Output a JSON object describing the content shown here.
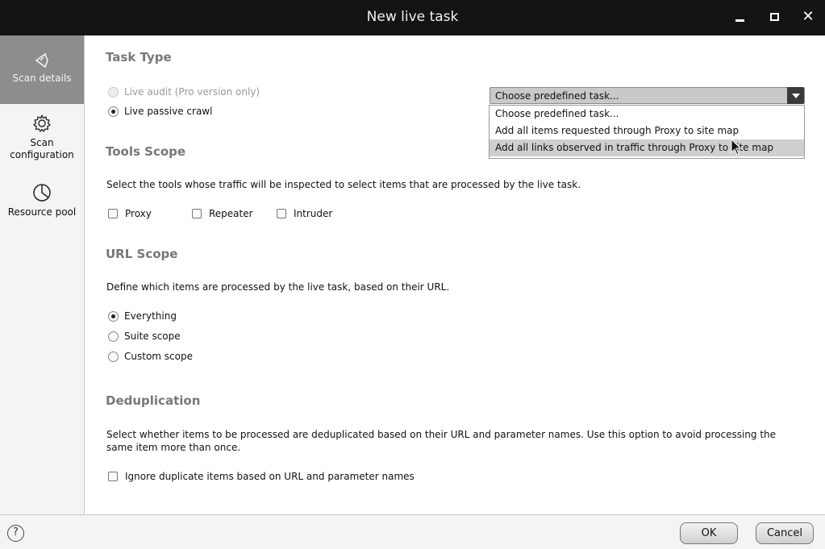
{
  "window": {
    "title": "New live task"
  },
  "sidebar": {
    "items": [
      {
        "label": "Scan details",
        "icon": "scan-details-icon",
        "active": true
      },
      {
        "label": "Scan configuration",
        "icon": "gear-icon",
        "active": false
      },
      {
        "label": "Resource pool",
        "icon": "pie-chart-icon",
        "active": false
      }
    ]
  },
  "task_type": {
    "heading": "Task Type",
    "options": [
      {
        "label": "Live audit (Pro version only)",
        "selected": false,
        "disabled": true
      },
      {
        "label": "Live passive crawl",
        "selected": true,
        "disabled": false
      }
    ],
    "dropdown": {
      "selected": "Choose predefined task...",
      "options": [
        "Choose predefined task...",
        "Add all items requested through Proxy to site map",
        "Add all links observed in traffic through Proxy to site map"
      ],
      "highlighted_index": 2
    }
  },
  "tools_scope": {
    "heading": "Tools Scope",
    "description": "Select the tools whose traffic will be inspected to select items that are processed by the live task.",
    "tools": [
      {
        "label": "Proxy",
        "checked": false
      },
      {
        "label": "Repeater",
        "checked": false
      },
      {
        "label": "Intruder",
        "checked": false
      }
    ]
  },
  "url_scope": {
    "heading": "URL Scope",
    "description": "Define which items are processed by the live task, based on their URL.",
    "options": [
      {
        "label": "Everything",
        "selected": true
      },
      {
        "label": "Suite scope",
        "selected": false
      },
      {
        "label": "Custom scope",
        "selected": false
      }
    ]
  },
  "deduplication": {
    "heading": "Deduplication",
    "description_line1": "Select whether items to be processed are deduplicated based on their URL and parameter names. Use this option to avoid processing the",
    "description_line2": "same item more than once.",
    "checkbox_label": "Ignore duplicate items based on URL and parameter names",
    "checked": false
  },
  "footer": {
    "help": "?",
    "ok_label": "OK",
    "cancel_label": "Cancel"
  },
  "colors": {
    "titlebar": "#141414",
    "sidebar_active": "#8d8d8d",
    "heading": "#777777",
    "menu_highlight": "#cfcfcf"
  }
}
